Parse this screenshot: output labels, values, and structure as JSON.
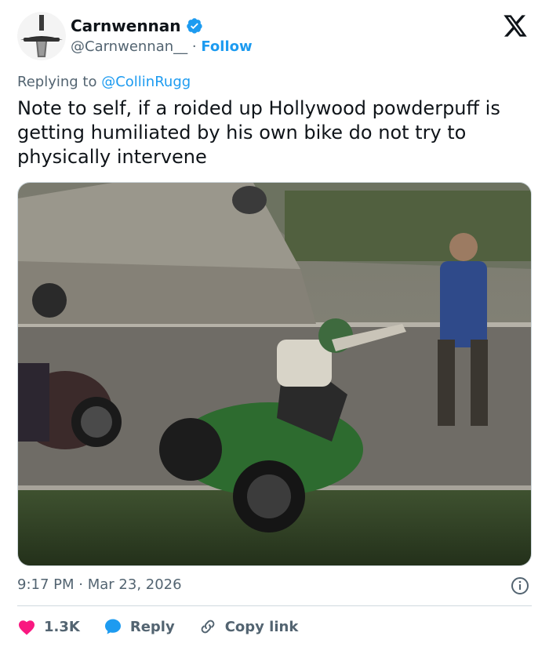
{
  "author": {
    "name": "Carnwennan",
    "handle": "@Carnwennan__",
    "separator": "·",
    "follow_label": "Follow"
  },
  "reply_context": {
    "prefix": "Replying to",
    "mention": "@CollinRugg"
  },
  "tweet": {
    "text": "Note to self, if a roided up Hollywood powderpuff is getting humiliated by his own bike do not try to physically intervene",
    "time": "9:17 PM",
    "date_separator": "·",
    "date": "Mar 23, 2026"
  },
  "engagement": {
    "likes": "1.3K",
    "reply_label": "Reply",
    "copy_link_label": "Copy link"
  },
  "icons": {
    "avatar": "sword-avatar",
    "verified": "verified-badge-icon",
    "logo": "x-logo-icon",
    "info": "info-icon",
    "like": "heart-icon",
    "reply": "speech-bubble-icon",
    "link": "link-icon"
  },
  "colors": {
    "accent": "#1d9bf0",
    "like": "#f91880",
    "text": "#0f1419",
    "muted": "#536471",
    "border": "#cfd9de"
  }
}
